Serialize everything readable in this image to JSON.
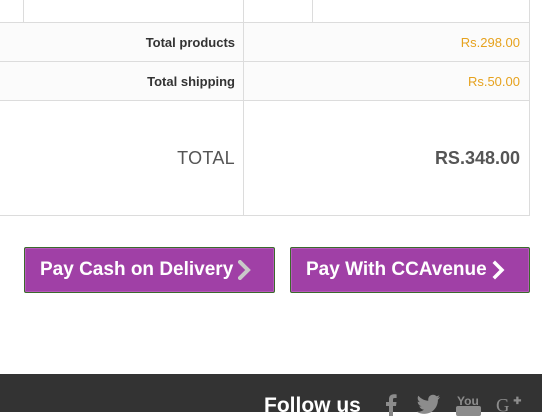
{
  "summary": {
    "products_label": "Total products",
    "products_value": "Rs.298.00",
    "shipping_label": "Total shipping",
    "shipping_value": "Rs.50.00",
    "total_label": "TOTAL",
    "total_value": "RS.348.00"
  },
  "payment": {
    "cod_label": "Pay Cash on Delivery",
    "ccavenue_label": "Pay With CCAvenue"
  },
  "footer": {
    "follow_label": "Follow us",
    "social_icons": [
      "facebook-icon",
      "twitter-icon",
      "youtube-icon",
      "google-plus-icon"
    ]
  },
  "colors": {
    "button_bg": "#a040a6",
    "price_accent": "#e6a21e",
    "footer_bg": "#333333"
  }
}
